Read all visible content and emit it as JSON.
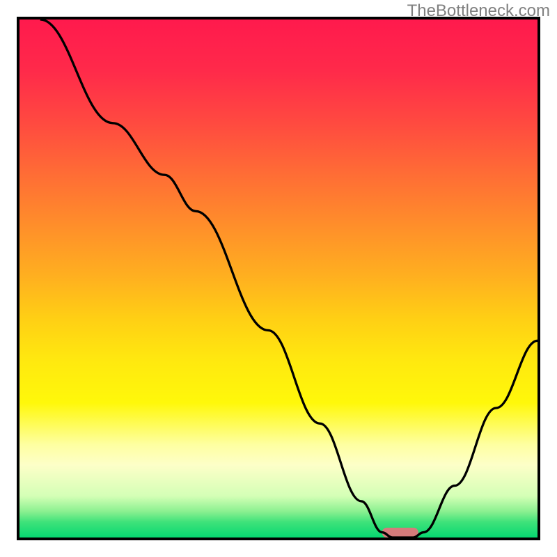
{
  "watermark": "TheBottleneck.com",
  "chart_data": {
    "type": "line",
    "title": "",
    "xlabel": "",
    "ylabel": "",
    "xlim": [
      0,
      100
    ],
    "ylim": [
      0,
      100
    ],
    "curve_points": [
      [
        4,
        100
      ],
      [
        18,
        80
      ],
      [
        28,
        70
      ],
      [
        34,
        63
      ],
      [
        48,
        40
      ],
      [
        58,
        22
      ],
      [
        66,
        7
      ],
      [
        70,
        1
      ],
      [
        72,
        0
      ],
      [
        76,
        0
      ],
      [
        78,
        1
      ],
      [
        84,
        10
      ],
      [
        92,
        25
      ],
      [
        100,
        38
      ]
    ],
    "optimal_marker": {
      "x_start": 70,
      "x_end": 77,
      "y": 0,
      "color": "#d57b7b"
    },
    "gradient_stops": [
      {
        "offset": 0.0,
        "color": "#ff1a4d"
      },
      {
        "offset": 0.1,
        "color": "#ff2a4a"
      },
      {
        "offset": 0.2,
        "color": "#ff4a40"
      },
      {
        "offset": 0.3,
        "color": "#ff6d35"
      },
      {
        "offset": 0.4,
        "color": "#ff8f2a"
      },
      {
        "offset": 0.5,
        "color": "#ffb11f"
      },
      {
        "offset": 0.58,
        "color": "#ffd014"
      },
      {
        "offset": 0.66,
        "color": "#ffe90f"
      },
      {
        "offset": 0.74,
        "color": "#fff80a"
      },
      {
        "offset": 0.82,
        "color": "#feffa0"
      },
      {
        "offset": 0.86,
        "color": "#fdffc8"
      },
      {
        "offset": 0.92,
        "color": "#d4ffb6"
      },
      {
        "offset": 0.95,
        "color": "#8af090"
      },
      {
        "offset": 0.97,
        "color": "#3fe27a"
      },
      {
        "offset": 1.0,
        "color": "#06d871"
      }
    ]
  }
}
